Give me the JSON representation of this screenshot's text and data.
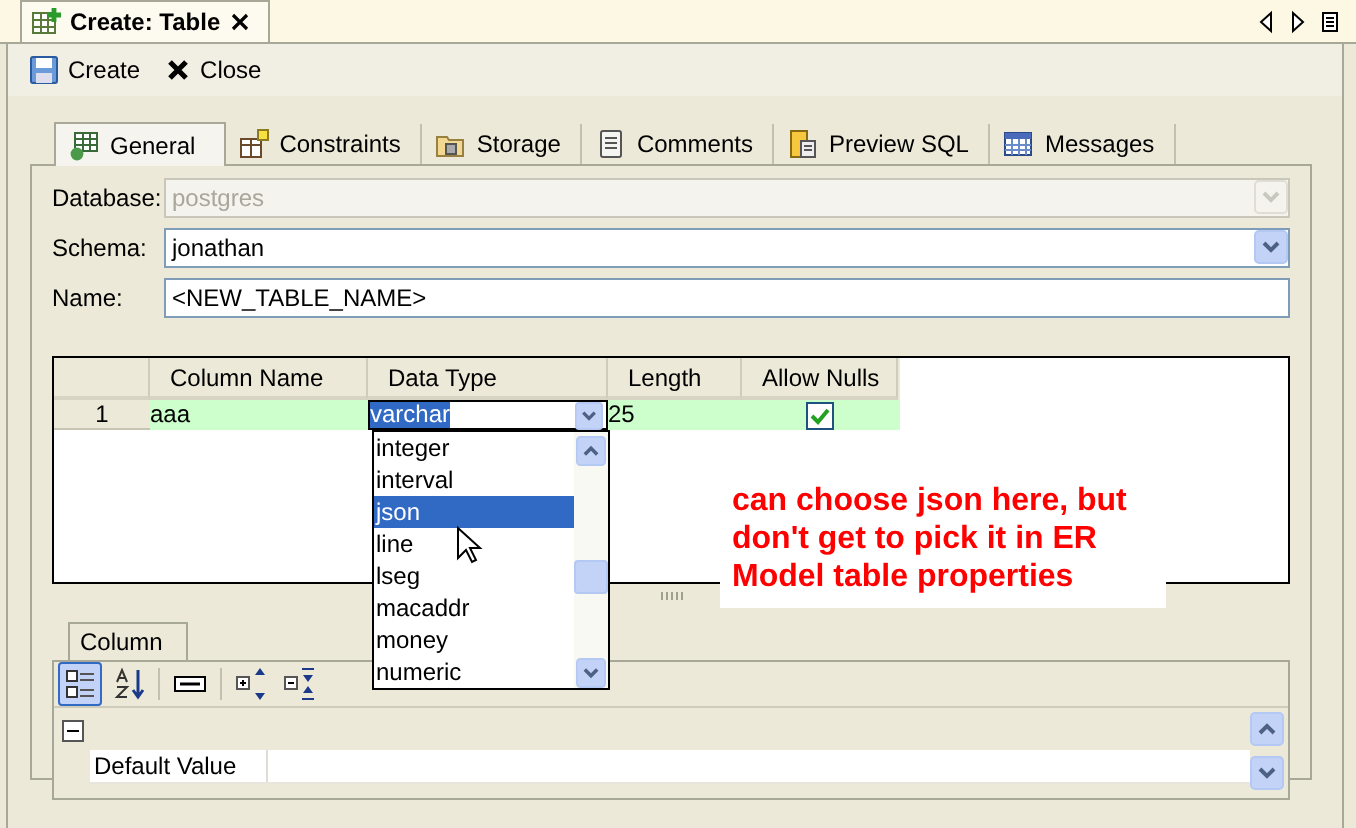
{
  "editor_tab": {
    "title": "Create: Table"
  },
  "toolbar": [
    {
      "label": "Create",
      "kind": "save"
    },
    {
      "label": "Close",
      "kind": "close"
    }
  ],
  "tabs": [
    {
      "label": "General",
      "kind": "general",
      "selected": true
    },
    {
      "label": "Constraints",
      "kind": "constraints",
      "selected": false
    },
    {
      "label": "Storage",
      "kind": "storage",
      "selected": false
    },
    {
      "label": "Comments",
      "kind": "comments",
      "selected": false
    },
    {
      "label": "Preview SQL",
      "kind": "sql",
      "selected": false
    },
    {
      "label": "Messages",
      "kind": "messages",
      "selected": false
    }
  ],
  "fields": [
    {
      "label": "Database:",
      "value": "postgres",
      "kind": "combo",
      "disabled": true
    },
    {
      "label": "Schema:",
      "value": "jonathan",
      "kind": "combo",
      "disabled": false
    },
    {
      "label": "Name:",
      "value": "<NEW_TABLE_NAME>",
      "kind": "text",
      "disabled": false
    }
  ],
  "grid": {
    "columns": [
      "Column Name",
      "Data Type",
      "Length",
      "Allow Nulls"
    ],
    "rows": [
      {
        "number": "1",
        "column_name": "aaa",
        "data_type": "varchar",
        "length": "25",
        "allow_nulls": true
      }
    ]
  },
  "type_dropdown": {
    "options": [
      {
        "label": "integer",
        "selected": false
      },
      {
        "label": "interval",
        "selected": false
      },
      {
        "label": "json",
        "selected": true
      },
      {
        "label": "line",
        "selected": false
      },
      {
        "label": "lseg",
        "selected": false
      },
      {
        "label": "macaddr",
        "selected": false
      },
      {
        "label": "money",
        "selected": false
      },
      {
        "label": "numeric",
        "selected": false
      }
    ]
  },
  "annotation": "can choose json here, but don't get to pick it in ER Model table properties",
  "bottom_panel": {
    "tab": "Column",
    "group_expanded": true,
    "properties": [
      {
        "name": "Default Value"
      }
    ]
  }
}
